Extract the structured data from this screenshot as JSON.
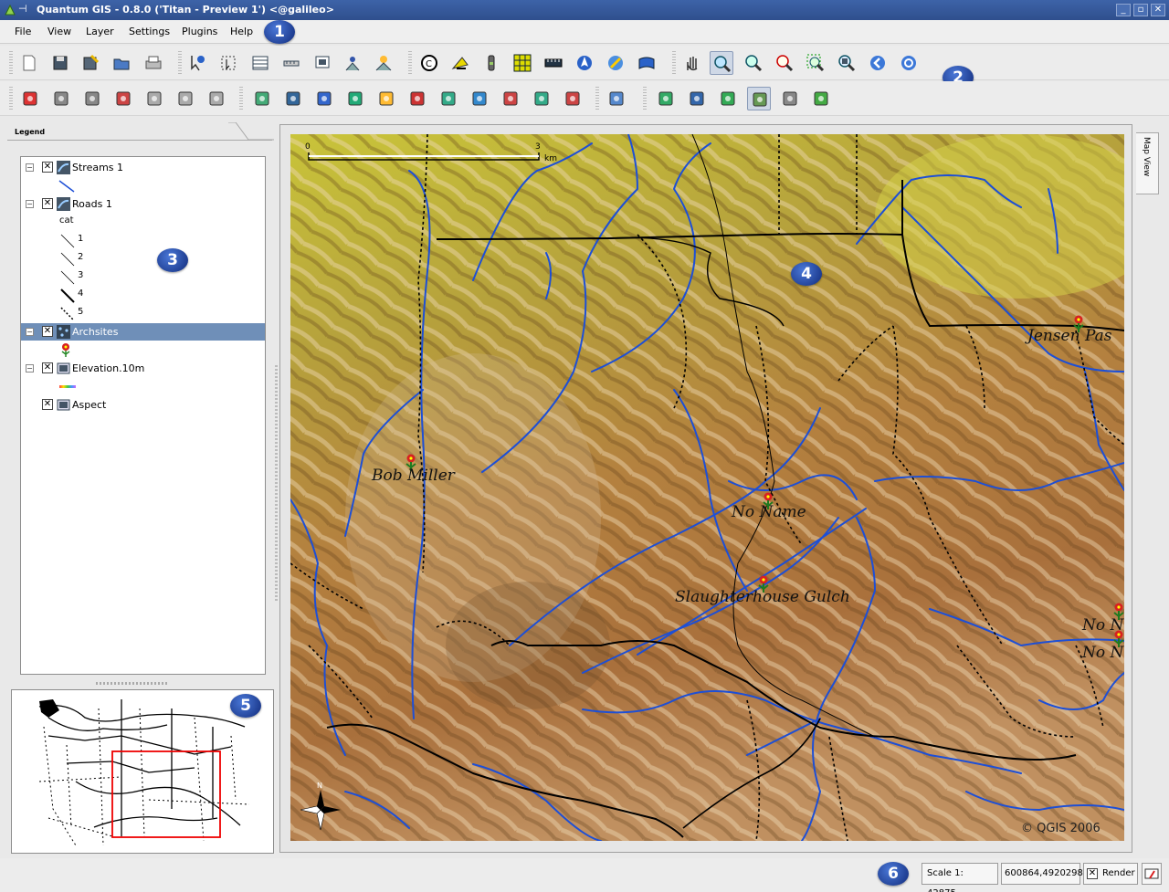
{
  "window": {
    "title": "Quantum GIS - 0.8.0 ('Titan - Preview 1') <@galileo>",
    "buttons": [
      "minimize-icon",
      "maximize-icon",
      "close-icon"
    ]
  },
  "menubar": {
    "items": [
      "File",
      "View",
      "Layer",
      "Settings",
      "Plugins",
      "Help"
    ]
  },
  "toolbars": {
    "file_tools": [
      "new-project-icon",
      "save-project-icon",
      "save-as-icon",
      "open-project-icon",
      "print-icon"
    ],
    "select_tools": [
      "identify-icon",
      "select-icon",
      "attribute-table-icon",
      "measure-line-icon",
      "map-tips-icon",
      "measure-area-icon",
      "capture-icon"
    ],
    "map_tools": [
      "copyright-icon",
      "north-arrow-icon",
      "scale-bar-icon",
      "grid-icon",
      "ruler-icon",
      "navigate-icon",
      "gps-icon",
      "script-icon"
    ],
    "nav_tools": [
      "pan-icon",
      "zoom-in-icon",
      "zoom-out-icon",
      "zoom-full-icon",
      "zoom-selection-icon",
      "zoom-layer-icon",
      "zoom-last-icon",
      "refresh-icon"
    ],
    "active_tool": "zoom-in-icon"
  },
  "callouts": [
    "1",
    "2",
    "3",
    "4",
    "5",
    "6"
  ],
  "legend": {
    "tab_label": "Legend",
    "layers": [
      {
        "name": "Streams 1",
        "checked": true,
        "expanded": true,
        "icon": "vector-line-icon"
      },
      {
        "name": "Roads 1",
        "checked": true,
        "expanded": true,
        "icon": "vector-line-icon",
        "field": "cat",
        "classes": [
          "1",
          "2",
          "3",
          "4",
          "5"
        ]
      },
      {
        "name": "Archsites",
        "checked": true,
        "expanded": true,
        "icon": "vector-point-icon",
        "selected": true
      },
      {
        "name": "Elevation.10m",
        "checked": true,
        "expanded": true,
        "icon": "raster-icon"
      },
      {
        "name": "Aspect",
        "checked": true,
        "expanded": false,
        "icon": "raster-icon"
      }
    ]
  },
  "map": {
    "tab_label": "Map View",
    "scalebar_start": "0",
    "scalebar_end": "3",
    "scalebar_unit": "km",
    "north_label": "N",
    "copyright": "© QGIS 2006",
    "labels": [
      "Bob Miller",
      "No Name",
      "Slaughterhouse Gulch",
      "Jensen Pas",
      "No N",
      "No N"
    ],
    "colors": {
      "stream": "#1d4fd6",
      "road": "#000000",
      "site": "#d82020"
    }
  },
  "statusbar": {
    "scale": "Scale 1: 42875",
    "coords": "600864,4920298",
    "render_label": "Render",
    "render_checked": true
  }
}
